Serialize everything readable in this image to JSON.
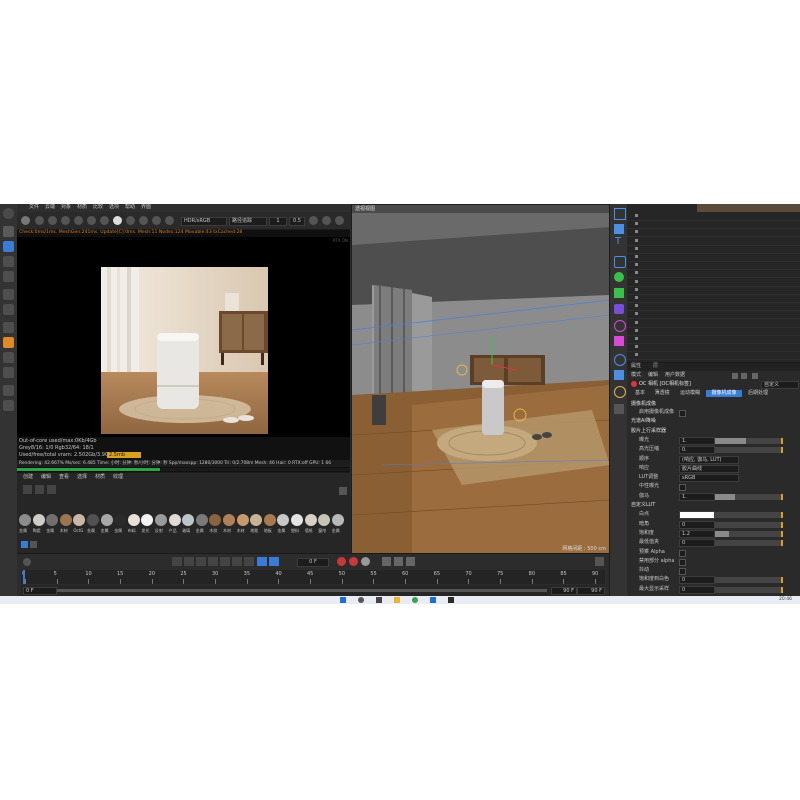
{
  "render_window": {
    "menu": [
      "文件",
      "云端",
      "对象",
      "材质",
      "比较",
      "选项",
      "帮助",
      "界面"
    ],
    "colorspace": "HDR/sRGB",
    "mode": "路径追踪",
    "frame_value": "1",
    "zoom_value": "0.5",
    "status_line": "Check:0ms/1ms. MeshGen:241ms. Update[C]:0ms. Mesh:11 Nodes:124 Movable:43 txCached:28",
    "corner_info": "RTX ON",
    "stats": {
      "line1": "Out-of-core used/max:0Kb/4Gb",
      "line2": "Grey8/16: 1/0     Rgb32/64: 18/1",
      "line3": "Used/free/total vram: 2.502Gb/3.907Gb/6Gb",
      "line3_badge": "2.5mb",
      "rendering": "Rendering: 42.667%   Ms/sec: 6.485   Time: 小时: 分钟: 秒/小时: 分钟: 秒   Spp/maxspp: 1280/3000   Tri: 0/2.708m   Mesh: 46   Hair: 0   RTX:off   GPU: 1   66"
    }
  },
  "material_panel": {
    "menu": [
      "创建",
      "编辑",
      "查看",
      "选择",
      "材质",
      "纹理"
    ],
    "swatches": [
      {
        "label": "金属",
        "color": "#8c8c8c"
      },
      {
        "label": "陶瓷",
        "color": "#d0ccc6"
      },
      {
        "label": "金属",
        "color": "#6f6f6f"
      },
      {
        "label": "木材",
        "color": "#9a7550"
      },
      {
        "label": "OctG",
        "color": "#c7b9a6"
      },
      {
        "label": "金属",
        "color": "#515151"
      },
      {
        "label": "金属",
        "color": "#a8a8a8"
      },
      {
        "label": "金属",
        "color": "#2a2a2a"
      },
      {
        "label": "布料",
        "color": "#e6e0d6"
      },
      {
        "label": "发光",
        "color": "#f4f4f4"
      },
      {
        "label": "反射",
        "color": "#9a9a9a"
      },
      {
        "label": "产品",
        "color": "#dedad4"
      },
      {
        "label": "玻璃",
        "color": "#bcc5c8"
      },
      {
        "label": "金属",
        "color": "#7a7a7a"
      },
      {
        "label": "木纹",
        "color": "#8a6340"
      },
      {
        "label": "木材",
        "color": "#b08056"
      },
      {
        "label": "木材",
        "color": "#c79a6e"
      },
      {
        "label": "地毯",
        "color": "#c7b395"
      },
      {
        "label": "地板",
        "color": "#a87a4d"
      },
      {
        "label": "金属",
        "color": "#c8c8c8"
      },
      {
        "label": "塑料",
        "color": "#e4e4e4"
      },
      {
        "label": "墙纸",
        "color": "#d6d0c6"
      },
      {
        "label": "窗帘",
        "color": "#c9c2b6"
      },
      {
        "label": "金属",
        "color": "#b7b7b7"
      }
    ]
  },
  "viewport": {
    "label": "透视视图",
    "grid_info": "网格间距 : 500 cm"
  },
  "timeline": {
    "current_frame": "0 F",
    "end_frame": "90 F",
    "start_field": "0 F",
    "end_field": "90 F",
    "ticks": [
      "0",
      "5",
      "10",
      "15",
      "20",
      "25",
      "30",
      "35",
      "40",
      "45",
      "50",
      "55",
      "60",
      "65",
      "70",
      "75",
      "80",
      "85",
      "90"
    ]
  },
  "attributes": {
    "tabs_top": [
      "属性",
      "层"
    ],
    "menu": [
      "模式",
      "编辑",
      "用户数据"
    ],
    "object_title": "OC 相机 [OC相机标签]",
    "preset": "自定义",
    "tabs": [
      "基本",
      "薄透镜",
      "运动模糊",
      "摄像机成像",
      "后期处理"
    ],
    "section_title": "摄像机成像",
    "rows": [
      {
        "label": "启用摄像机成像",
        "kind": "check"
      },
      {
        "label": "光谱AI降噪",
        "kind": "section"
      },
      {
        "label": "胶片上行采样器",
        "kind": "section"
      },
      {
        "label": "曝光",
        "value": "1.",
        "fill": 0.45
      },
      {
        "label": "高光压缩",
        "value": "0.",
        "fill": 0.0
      },
      {
        "label": "顺序",
        "value": "(响应, 伽马, LUT)",
        "fill": 0
      },
      {
        "label": "响应",
        "value": "胶片曲线",
        "fill": 0
      },
      {
        "label": "LUT调整",
        "value": "sRGB",
        "fill": 0
      },
      {
        "label": "中性曝光",
        "kind": "check"
      },
      {
        "label": "伽马",
        "value": "1.",
        "fill": 0.3
      },
      {
        "label": "自定义LUT",
        "kind": "section"
      },
      {
        "label": "白点",
        "value": "",
        "fill": 0
      },
      {
        "label": "暗角",
        "value": "0",
        "fill": 0
      },
      {
        "label": "饱和度",
        "value": "1.2",
        "fill": 0.2
      },
      {
        "label": "最低值夹",
        "value": "0",
        "fill": 0
      },
      {
        "label": "预乘 Alpha",
        "kind": "check"
      },
      {
        "label": "禁用部分 alpha",
        "kind": "check"
      },
      {
        "label": "抖动",
        "kind": "check"
      },
      {
        "label": "饱和度到白色",
        "value": "0",
        "fill": 0
      },
      {
        "label": "最大显示采样",
        "value": "0",
        "fill": 0
      }
    ]
  },
  "taskbar": {
    "clock": "20:46"
  }
}
